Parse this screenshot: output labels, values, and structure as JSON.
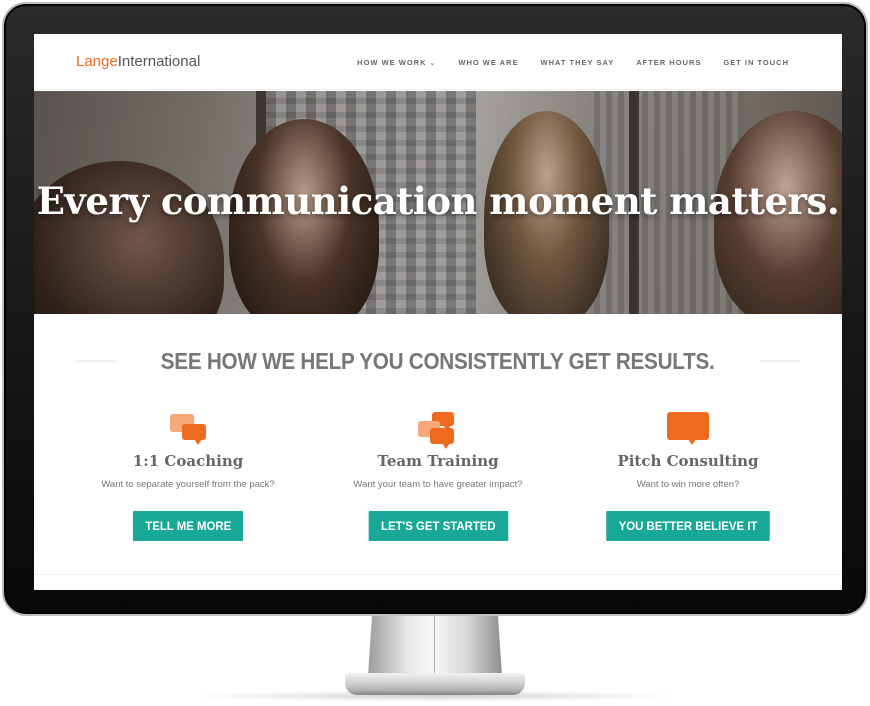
{
  "brand": {
    "prefix": "Lange",
    "suffix": "International"
  },
  "nav": {
    "items": [
      {
        "label": "HOW WE WORK",
        "has_dropdown": true
      },
      {
        "label": "WHO WE ARE"
      },
      {
        "label": "WHAT THEY SAY"
      },
      {
        "label": "AFTER HOURS"
      },
      {
        "label": "GET IN TOUCH"
      }
    ],
    "dropdown_glyph": "⌄"
  },
  "hero": {
    "title": "Every communication moment matters."
  },
  "services_section": {
    "heading": "SEE HOW WE HELP YOU CONSISTENTLY GET RESULTS.",
    "services": [
      {
        "name": "1:1 Coaching",
        "description": "Want to separate yourself from the pack?",
        "button": "TELL ME MORE",
        "icon": "two-chat-bubbles-icon"
      },
      {
        "name": "Team Training",
        "description": "Want your team to have greater impact?",
        "button": "LET'S GET STARTED",
        "icon": "three-chat-bubbles-icon"
      },
      {
        "name": "Pitch Consulting",
        "description": "Want to win more often?",
        "button": "YOU BETTER BELIEVE IT",
        "icon": "single-chat-bubble-icon"
      }
    ]
  },
  "colors": {
    "accent_orange": "#ee6a1f",
    "light_orange": "#f6a878",
    "teal_button": "#17a897",
    "heading_gray": "#777777"
  }
}
